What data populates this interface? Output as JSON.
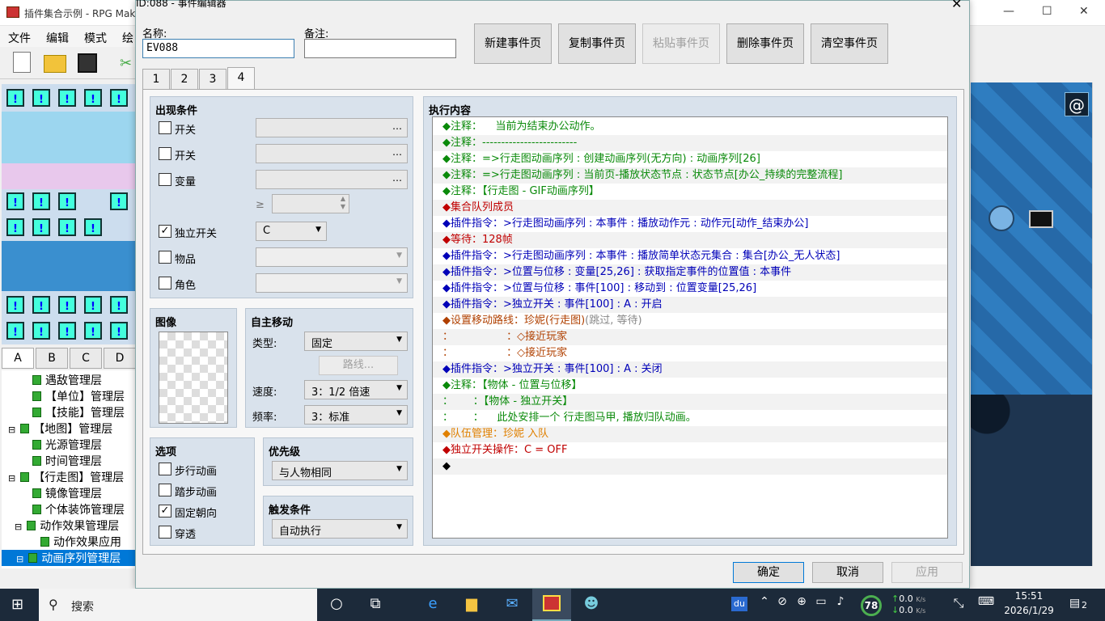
{
  "main_window": {
    "title": "插件集合示例 - RPG Mak",
    "menu": [
      "文件",
      "编辑",
      "模式",
      "绘"
    ],
    "tile_tabs": [
      "A",
      "B",
      "C",
      "D"
    ],
    "tree": [
      {
        "label": "遇敌管理层",
        "indent": 1
      },
      {
        "label": "【单位】管理层",
        "indent": 1
      },
      {
        "label": "【技能】管理层",
        "indent": 1
      },
      {
        "label": "【地图】管理层",
        "indent": 0,
        "toggle": "⊟"
      },
      {
        "label": "光源管理层",
        "indent": 1
      },
      {
        "label": "时间管理层",
        "indent": 1
      },
      {
        "label": "【行走图】管理层",
        "indent": 0,
        "toggle": "⊟"
      },
      {
        "label": "镜像管理层",
        "indent": 1
      },
      {
        "label": "个体装饰管理层",
        "indent": 1
      },
      {
        "label": "动作效果管理层",
        "indent": 1,
        "toggle": "⊟"
      },
      {
        "label": "动作效果应用",
        "indent": 2
      },
      {
        "label": "动画序列管理层",
        "indent": 1,
        "toggle": "⊟",
        "selected": true
      }
    ]
  },
  "dialog": {
    "title": "ID:088 - 事件编辑器",
    "close": "✕",
    "name_label": "名称:",
    "name_value": "EV088",
    "note_label": "备注:",
    "note_value": "",
    "page_buttons": [
      {
        "label": "新建事件页",
        "disabled": false
      },
      {
        "label": "复制事件页",
        "disabled": false
      },
      {
        "label": "粘贴事件页",
        "disabled": true
      },
      {
        "label": "删除事件页",
        "disabled": false
      },
      {
        "label": "清空事件页",
        "disabled": false
      }
    ],
    "tabs": [
      "1",
      "2",
      "3",
      "4"
    ],
    "active_tab": "4",
    "conditions": {
      "title": "出现条件",
      "switch1": {
        "label": "开关",
        "checked": false,
        "value": "",
        "button": "…"
      },
      "switch2": {
        "label": "开关",
        "checked": false,
        "value": "",
        "button": "…"
      },
      "variable": {
        "label": "变量",
        "checked": false,
        "value": "",
        "button": "…",
        "op": "≥",
        "number": ""
      },
      "self_switch": {
        "label": "独立开关",
        "checked": true,
        "value": "C"
      },
      "item": {
        "label": "物品",
        "checked": false,
        "value": ""
      },
      "actor": {
        "label": "角色",
        "checked": false,
        "value": ""
      }
    },
    "image": {
      "title": "图像"
    },
    "autonomous": {
      "title": "自主移动",
      "type_label": "类型:",
      "type_value": "固定",
      "route_button": "路线...",
      "speed_label": "速度:",
      "speed_value": "3：1/2 倍速",
      "freq_label": "频率:",
      "freq_value": "3：标准"
    },
    "options": {
      "title": "选项",
      "items": [
        {
          "label": "步行动画",
          "checked": false
        },
        {
          "label": "踏步动画",
          "checked": false
        },
        {
          "label": "固定朝向",
          "checked": true
        },
        {
          "label": "穿透",
          "checked": false
        }
      ]
    },
    "priority": {
      "title": "优先级",
      "value": "与人物相同"
    },
    "trigger": {
      "title": "触发条件",
      "value": "自动执行"
    },
    "contents": {
      "title": "执行内容",
      "lines": [
        {
          "text": "◆注释：    当前为结束办公动作。",
          "cls": "g"
        },
        {
          "text": "◆注释：-------------------------",
          "cls": "g"
        },
        {
          "text": "◆注释：=>行走图动画序列 : 创建动画序列(无方向) : 动画序列[26]",
          "cls": "g"
        },
        {
          "text": "◆注释：=>行走图动画序列 : 当前页-播放状态节点 : 状态节点[办公_持续的完整流程]",
          "cls": "g"
        },
        {
          "text": "◆注释：【行走图 - GIF动画序列】",
          "cls": "g"
        },
        {
          "text": "◆集合队列成员",
          "cls": "r"
        },
        {
          "text": "◆插件指令：>行走图动画序列 : 本事件 : 播放动作元 : 动作元[动作_结束办公]",
          "cls": "n"
        },
        {
          "text": "◆等待：128帧",
          "cls": "r"
        },
        {
          "text": "◆插件指令：>行走图动画序列 : 本事件 : 播放简单状态元集合 : 集合[办公_无人状态]",
          "cls": "n"
        },
        {
          "text": "◆插件指令：>位置与位移 : 变量[25,26] : 获取指定事件的位置值 : 本事件",
          "cls": "n"
        },
        {
          "text": "◆插件指令：>位置与位移 : 事件[100] : 移动到 : 位置变量[25,26]",
          "cls": "n"
        },
        {
          "text": "◆插件指令：>独立开关 : 事件[100] : A : 开启",
          "cls": "n"
        },
        {
          "text": "◆设置移动路线：珍妮(行走图)",
          "cls": "br",
          "extra": "(跳过, 等待)"
        },
        {
          "text": "：                ：◇接近玩家",
          "cls": "br"
        },
        {
          "text": "：                ：◇接近玩家",
          "cls": "br"
        },
        {
          "text": "◆插件指令：>独立开关 : 事件[100] : A : 关闭",
          "cls": "n"
        },
        {
          "text": "◆注释：【物体 - 位置与位移】",
          "cls": "g"
        },
        {
          "text": "：      ：【物体 - 独立开关】",
          "cls": "g"
        },
        {
          "text": "：      ：    此处安排一个 行走图马甲, 播放归队动画。",
          "cls": "g"
        },
        {
          "text": "◆队伍管理：珍妮 入队",
          "cls": "o"
        },
        {
          "text": "◆独立开关操作：C = OFF",
          "cls": "r"
        },
        {
          "text": "◆",
          "cls": "k"
        }
      ]
    },
    "footer": {
      "ok": "确定",
      "cancel": "取消",
      "apply": "应用"
    }
  },
  "taskbar": {
    "search_placeholder": "搜索",
    "battery": "78",
    "net_up": "0.0",
    "net_down": "0.0",
    "net_unit": "K/s",
    "time": "15:51",
    "date": "2026/1/29",
    "notifications": "2",
    "tray_du": "du",
    "colors": {
      "bg": "#1c2a3a",
      "accent": "#0078d7"
    }
  }
}
